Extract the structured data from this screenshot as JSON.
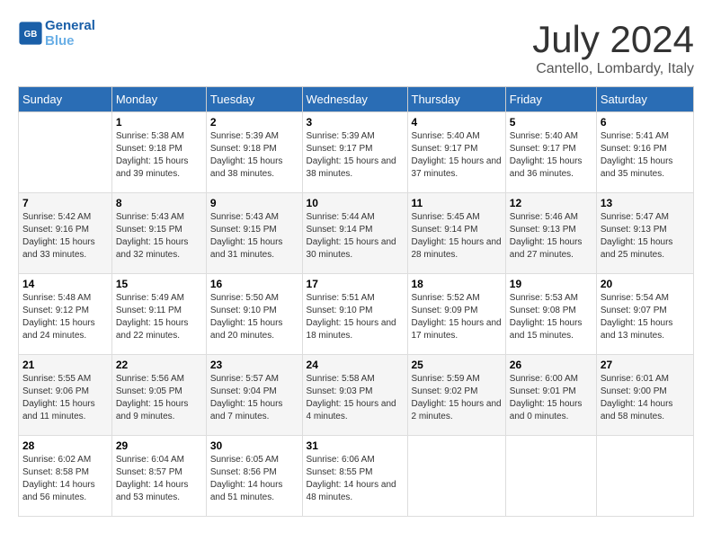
{
  "header": {
    "logo_text_general": "General",
    "logo_text_blue": "Blue",
    "month_title": "July 2024",
    "subtitle": "Cantello, Lombardy, Italy"
  },
  "columns": [
    "Sunday",
    "Monday",
    "Tuesday",
    "Wednesday",
    "Thursday",
    "Friday",
    "Saturday"
  ],
  "weeks": [
    [
      {
        "day": "",
        "sunrise": "",
        "sunset": "",
        "daylight": ""
      },
      {
        "day": "1",
        "sunrise": "Sunrise: 5:38 AM",
        "sunset": "Sunset: 9:18 PM",
        "daylight": "Daylight: 15 hours and 39 minutes."
      },
      {
        "day": "2",
        "sunrise": "Sunrise: 5:39 AM",
        "sunset": "Sunset: 9:18 PM",
        "daylight": "Daylight: 15 hours and 38 minutes."
      },
      {
        "day": "3",
        "sunrise": "Sunrise: 5:39 AM",
        "sunset": "Sunset: 9:17 PM",
        "daylight": "Daylight: 15 hours and 38 minutes."
      },
      {
        "day": "4",
        "sunrise": "Sunrise: 5:40 AM",
        "sunset": "Sunset: 9:17 PM",
        "daylight": "Daylight: 15 hours and 37 minutes."
      },
      {
        "day": "5",
        "sunrise": "Sunrise: 5:40 AM",
        "sunset": "Sunset: 9:17 PM",
        "daylight": "Daylight: 15 hours and 36 minutes."
      },
      {
        "day": "6",
        "sunrise": "Sunrise: 5:41 AM",
        "sunset": "Sunset: 9:16 PM",
        "daylight": "Daylight: 15 hours and 35 minutes."
      }
    ],
    [
      {
        "day": "7",
        "sunrise": "Sunrise: 5:42 AM",
        "sunset": "Sunset: 9:16 PM",
        "daylight": "Daylight: 15 hours and 33 minutes."
      },
      {
        "day": "8",
        "sunrise": "Sunrise: 5:43 AM",
        "sunset": "Sunset: 9:15 PM",
        "daylight": "Daylight: 15 hours and 32 minutes."
      },
      {
        "day": "9",
        "sunrise": "Sunrise: 5:43 AM",
        "sunset": "Sunset: 9:15 PM",
        "daylight": "Daylight: 15 hours and 31 minutes."
      },
      {
        "day": "10",
        "sunrise": "Sunrise: 5:44 AM",
        "sunset": "Sunset: 9:14 PM",
        "daylight": "Daylight: 15 hours and 30 minutes."
      },
      {
        "day": "11",
        "sunrise": "Sunrise: 5:45 AM",
        "sunset": "Sunset: 9:14 PM",
        "daylight": "Daylight: 15 hours and 28 minutes."
      },
      {
        "day": "12",
        "sunrise": "Sunrise: 5:46 AM",
        "sunset": "Sunset: 9:13 PM",
        "daylight": "Daylight: 15 hours and 27 minutes."
      },
      {
        "day": "13",
        "sunrise": "Sunrise: 5:47 AM",
        "sunset": "Sunset: 9:13 PM",
        "daylight": "Daylight: 15 hours and 25 minutes."
      }
    ],
    [
      {
        "day": "14",
        "sunrise": "Sunrise: 5:48 AM",
        "sunset": "Sunset: 9:12 PM",
        "daylight": "Daylight: 15 hours and 24 minutes."
      },
      {
        "day": "15",
        "sunrise": "Sunrise: 5:49 AM",
        "sunset": "Sunset: 9:11 PM",
        "daylight": "Daylight: 15 hours and 22 minutes."
      },
      {
        "day": "16",
        "sunrise": "Sunrise: 5:50 AM",
        "sunset": "Sunset: 9:10 PM",
        "daylight": "Daylight: 15 hours and 20 minutes."
      },
      {
        "day": "17",
        "sunrise": "Sunrise: 5:51 AM",
        "sunset": "Sunset: 9:10 PM",
        "daylight": "Daylight: 15 hours and 18 minutes."
      },
      {
        "day": "18",
        "sunrise": "Sunrise: 5:52 AM",
        "sunset": "Sunset: 9:09 PM",
        "daylight": "Daylight: 15 hours and 17 minutes."
      },
      {
        "day": "19",
        "sunrise": "Sunrise: 5:53 AM",
        "sunset": "Sunset: 9:08 PM",
        "daylight": "Daylight: 15 hours and 15 minutes."
      },
      {
        "day": "20",
        "sunrise": "Sunrise: 5:54 AM",
        "sunset": "Sunset: 9:07 PM",
        "daylight": "Daylight: 15 hours and 13 minutes."
      }
    ],
    [
      {
        "day": "21",
        "sunrise": "Sunrise: 5:55 AM",
        "sunset": "Sunset: 9:06 PM",
        "daylight": "Daylight: 15 hours and 11 minutes."
      },
      {
        "day": "22",
        "sunrise": "Sunrise: 5:56 AM",
        "sunset": "Sunset: 9:05 PM",
        "daylight": "Daylight: 15 hours and 9 minutes."
      },
      {
        "day": "23",
        "sunrise": "Sunrise: 5:57 AM",
        "sunset": "Sunset: 9:04 PM",
        "daylight": "Daylight: 15 hours and 7 minutes."
      },
      {
        "day": "24",
        "sunrise": "Sunrise: 5:58 AM",
        "sunset": "Sunset: 9:03 PM",
        "daylight": "Daylight: 15 hours and 4 minutes."
      },
      {
        "day": "25",
        "sunrise": "Sunrise: 5:59 AM",
        "sunset": "Sunset: 9:02 PM",
        "daylight": "Daylight: 15 hours and 2 minutes."
      },
      {
        "day": "26",
        "sunrise": "Sunrise: 6:00 AM",
        "sunset": "Sunset: 9:01 PM",
        "daylight": "Daylight: 15 hours and 0 minutes."
      },
      {
        "day": "27",
        "sunrise": "Sunrise: 6:01 AM",
        "sunset": "Sunset: 9:00 PM",
        "daylight": "Daylight: 14 hours and 58 minutes."
      }
    ],
    [
      {
        "day": "28",
        "sunrise": "Sunrise: 6:02 AM",
        "sunset": "Sunset: 8:58 PM",
        "daylight": "Daylight: 14 hours and 56 minutes."
      },
      {
        "day": "29",
        "sunrise": "Sunrise: 6:04 AM",
        "sunset": "Sunset: 8:57 PM",
        "daylight": "Daylight: 14 hours and 53 minutes."
      },
      {
        "day": "30",
        "sunrise": "Sunrise: 6:05 AM",
        "sunset": "Sunset: 8:56 PM",
        "daylight": "Daylight: 14 hours and 51 minutes."
      },
      {
        "day": "31",
        "sunrise": "Sunrise: 6:06 AM",
        "sunset": "Sunset: 8:55 PM",
        "daylight": "Daylight: 14 hours and 48 minutes."
      },
      {
        "day": "",
        "sunrise": "",
        "sunset": "",
        "daylight": ""
      },
      {
        "day": "",
        "sunrise": "",
        "sunset": "",
        "daylight": ""
      },
      {
        "day": "",
        "sunrise": "",
        "sunset": "",
        "daylight": ""
      }
    ]
  ]
}
